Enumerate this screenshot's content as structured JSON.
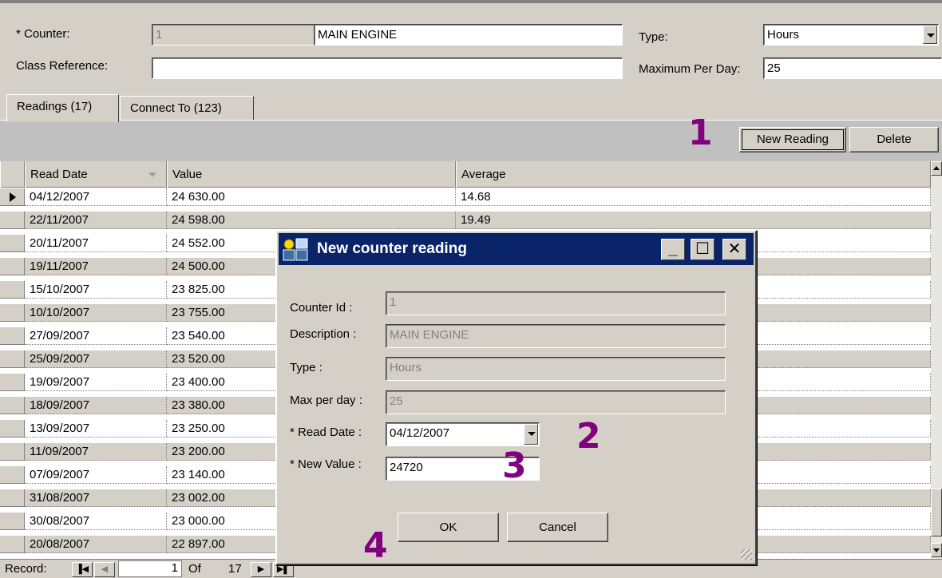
{
  "header": {
    "counter_label": "* Counter:",
    "counter_id": "1",
    "counter_name": "MAIN ENGINE",
    "type_label": "Type:",
    "type_value": "Hours",
    "class_ref_label": "Class Reference:",
    "class_ref_value": "",
    "max_per_day_label": "Maximum Per Day:",
    "max_per_day_value": "25"
  },
  "tabs": [
    {
      "label": "Readings (17)"
    },
    {
      "label": "Connect To (123)"
    }
  ],
  "toolbar": {
    "new_reading": "New Reading",
    "delete": "Delete"
  },
  "annotations": {
    "m1": "1",
    "m2": "2",
    "m3": "3",
    "m4": "4"
  },
  "grid": {
    "columns": [
      "Read Date",
      "Value",
      "Average"
    ],
    "rows": [
      {
        "date": "04/12/2007",
        "value": "24 630.00",
        "average": "14.68"
      },
      {
        "date": "22/11/2007",
        "value": "24 598.00",
        "average": "19.49"
      },
      {
        "date": "20/11/2007",
        "value": "24 552.00",
        "average": ""
      },
      {
        "date": "19/11/2007",
        "value": "24 500.00",
        "average": ""
      },
      {
        "date": "15/10/2007",
        "value": "23 825.00",
        "average": ""
      },
      {
        "date": "10/10/2007",
        "value": "23 755.00",
        "average": ""
      },
      {
        "date": "27/09/2007",
        "value": "23 540.00",
        "average": ""
      },
      {
        "date": "25/09/2007",
        "value": "23 520.00",
        "average": ""
      },
      {
        "date": "19/09/2007",
        "value": "23 400.00",
        "average": ""
      },
      {
        "date": "18/09/2007",
        "value": "23 380.00",
        "average": ""
      },
      {
        "date": "13/09/2007",
        "value": "23 250.00",
        "average": ""
      },
      {
        "date": "11/09/2007",
        "value": "23 200.00",
        "average": ""
      },
      {
        "date": "07/09/2007",
        "value": "23 140.00",
        "average": ""
      },
      {
        "date": "31/08/2007",
        "value": "23 002.00",
        "average": ""
      },
      {
        "date": "30/08/2007",
        "value": "23 000.00",
        "average": ""
      },
      {
        "date": "20/08/2007",
        "value": "22 897.00",
        "average": ""
      }
    ]
  },
  "navigator": {
    "record_label": "Record:",
    "current": "1",
    "of_label": "Of",
    "total": "17"
  },
  "dialog": {
    "title": "New counter reading",
    "counter_id_label": "Counter Id :",
    "counter_id_value": "1",
    "description_label": "Description :",
    "description_value": "MAIN ENGINE",
    "type_label": "Type :",
    "type_value": "Hours",
    "max_label": "Max per day :",
    "max_value": "25",
    "read_date_label": "* Read Date :",
    "read_date_value": "04/12/2007",
    "new_value_label": "* New Value :",
    "new_value_value": "24720",
    "ok": "OK",
    "cancel": "Cancel"
  },
  "colors": {
    "accent_titlebar": "#0a246a",
    "annotation": "#800080",
    "window_face": "#d4d0c8"
  }
}
